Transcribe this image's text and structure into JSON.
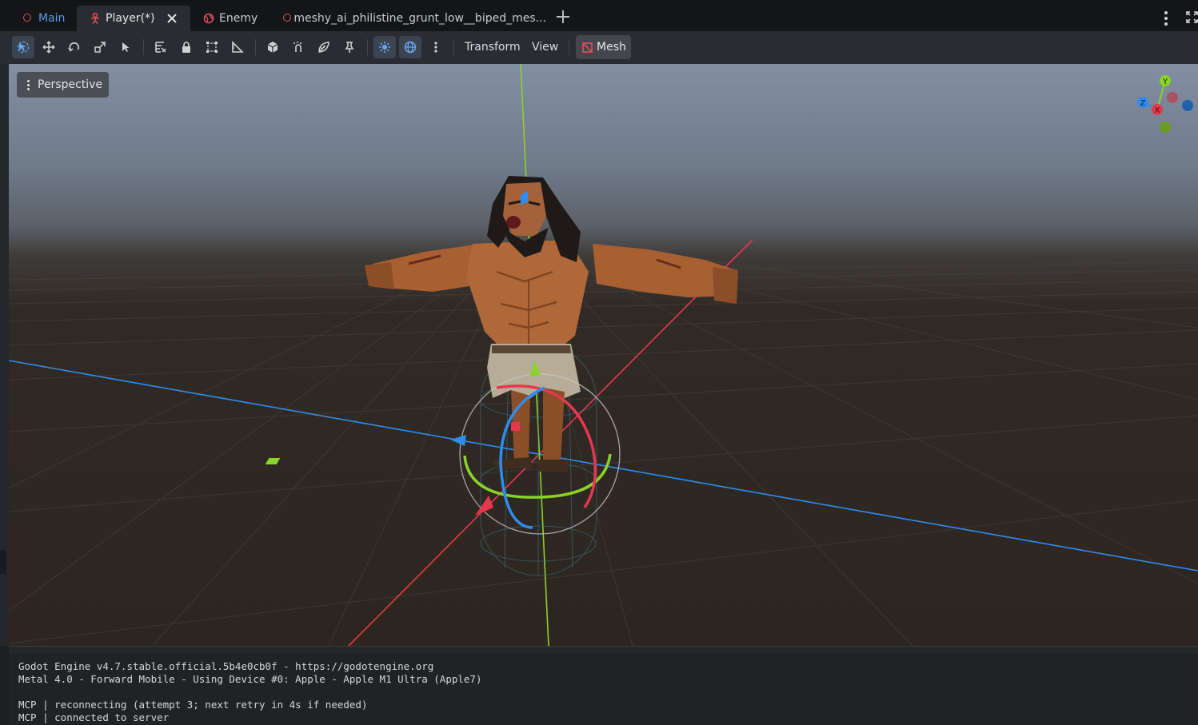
{
  "tabs": [
    {
      "label": "Main",
      "icon": "scene-ring-icon",
      "active": false
    },
    {
      "label": "Player(*)",
      "icon": "character-node-icon",
      "active": true
    },
    {
      "label": "Enemy",
      "icon": "globe-node-icon",
      "active": false
    },
    {
      "label": "meshy_ai_philistine_grunt_low__biped_mes...",
      "icon": "scene-ring-icon",
      "active": false
    }
  ],
  "toolbar": {
    "menus": {
      "transform": "Transform",
      "view": "View",
      "mesh": "Mesh"
    }
  },
  "viewport": {
    "camera_mode": "Perspective",
    "gizmo_axes": {
      "x": "X",
      "y": "Y",
      "z": "Z"
    }
  },
  "output": {
    "lines": [
      "Godot Engine v4.7.stable.official.5b4e0cb0f - https://godotengine.org",
      "Metal 4.0 - Forward Mobile - Using Device #0: Apple - Apple M1 Ultra (Apple7)",
      "",
      "MCP | reconnecting (attempt 3; next retry in 4s if needed)",
      "MCP | connected to server"
    ]
  },
  "colors": {
    "accent": "#5a9ee8",
    "axis_x": "#e5384e",
    "axis_y": "#8bd22a",
    "axis_z": "#2f8cf0"
  }
}
